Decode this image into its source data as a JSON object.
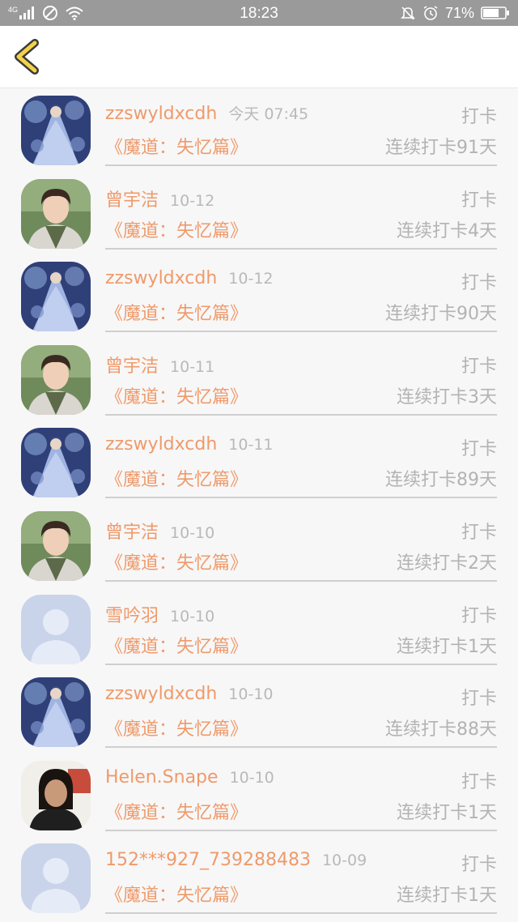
{
  "status_bar": {
    "network": "4G",
    "time": "18:23",
    "battery": "71%"
  },
  "colors": {
    "accent": "#ef9a6b",
    "muted": "#b3b3b3",
    "back_icon": "#f3d24a",
    "status_bar_bg": "#9a9a9a"
  },
  "items": [
    {
      "name": "zzswyldxcdh",
      "date": "今天 07:45",
      "tag": "打卡",
      "book": "《魔道：失忆篇》",
      "streak": "连续打卡91天",
      "avatar": "fairy"
    },
    {
      "name": "曾宇洁",
      "date": "10-12",
      "tag": "打卡",
      "book": "《魔道：失忆篇》",
      "streak": "连续打卡4天",
      "avatar": "boy"
    },
    {
      "name": "zzswyldxcdh",
      "date": "10-12",
      "tag": "打卡",
      "book": "《魔道：失忆篇》",
      "streak": "连续打卡90天",
      "avatar": "fairy"
    },
    {
      "name": "曾宇洁",
      "date": "10-11",
      "tag": "打卡",
      "book": "《魔道：失忆篇》",
      "streak": "连续打卡3天",
      "avatar": "boy"
    },
    {
      "name": "zzswyldxcdh",
      "date": "10-11",
      "tag": "打卡",
      "book": "《魔道：失忆篇》",
      "streak": "连续打卡89天",
      "avatar": "fairy"
    },
    {
      "name": "曾宇洁",
      "date": "10-10",
      "tag": "打卡",
      "book": "《魔道：失忆篇》",
      "streak": "连续打卡2天",
      "avatar": "boy"
    },
    {
      "name": "雪吟羽",
      "date": "10-10",
      "tag": "打卡",
      "book": "《魔道：失忆篇》",
      "streak": "连续打卡1天",
      "avatar": "default"
    },
    {
      "name": "zzswyldxcdh",
      "date": "10-10",
      "tag": "打卡",
      "book": "《魔道：失忆篇》",
      "streak": "连续打卡88天",
      "avatar": "fairy"
    },
    {
      "name": "Helen.Snape",
      "date": "10-10",
      "tag": "打卡",
      "book": "《魔道：失忆篇》",
      "streak": "连续打卡1天",
      "avatar": "woman"
    },
    {
      "name": "152***927_739288483",
      "date": "10-09",
      "tag": "打卡",
      "book": "《魔道：失忆篇》",
      "streak": "连续打卡1天",
      "avatar": "default"
    }
  ]
}
